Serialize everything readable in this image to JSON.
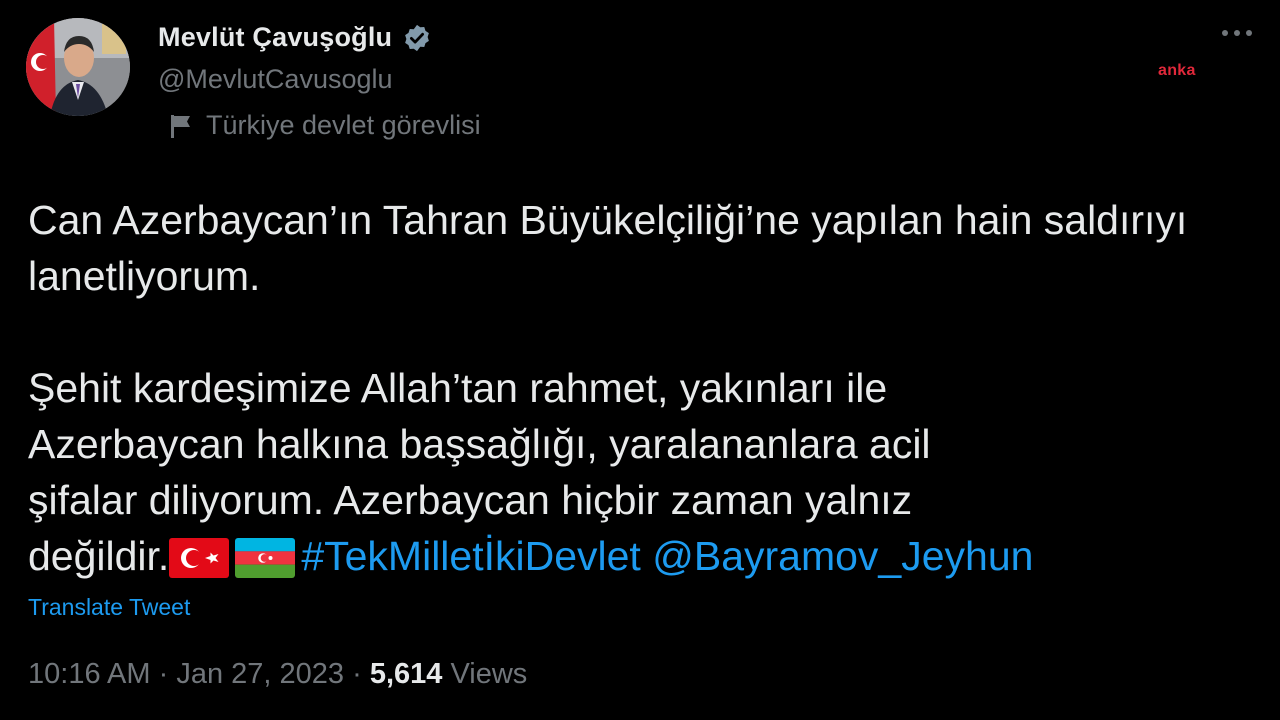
{
  "author": {
    "display_name": "Mevlüt Çavuşoğlu",
    "handle": "@MevlutCavusoglu",
    "affiliation": "Türkiye devlet görevlisi",
    "verified_icon": "verified-badge-icon",
    "avatar": "profile-photo"
  },
  "watermark": "anka",
  "tweet": {
    "paragraph1": "Can Azerbaycan’ın Tahran Büyükelçiliği’ne yapılan hain saldırıyı lanetliyorum.",
    "paragraph2_line1": "Şehit kardeşimize Allah’tan rahmet, yakınları ile",
    "paragraph2_line2": "Azerbaycan halkına başsağlığı, yaralananlara acil",
    "paragraph2_line3": "şifalar diliyorum. Azerbaycan hiçbir zaman yalnız",
    "paragraph2_line4_text": "değildir.",
    "emoji_flags": [
      "turkey-flag-icon",
      "azerbaijan-flag-icon"
    ],
    "hashtag": "#TekMilletİkiDevlet",
    "mention": "@Bayramov_Jeyhun"
  },
  "translate_label": "Translate Tweet",
  "meta": {
    "time": "10:16 AM",
    "separator": "·",
    "date": "Jan 27, 2023",
    "views_count": "5,614",
    "views_label": "Views"
  },
  "colors": {
    "background": "#000000",
    "text": "#e7e9ea",
    "secondary": "#71767b",
    "link": "#1d9bf0",
    "watermark": "#e0283a"
  }
}
